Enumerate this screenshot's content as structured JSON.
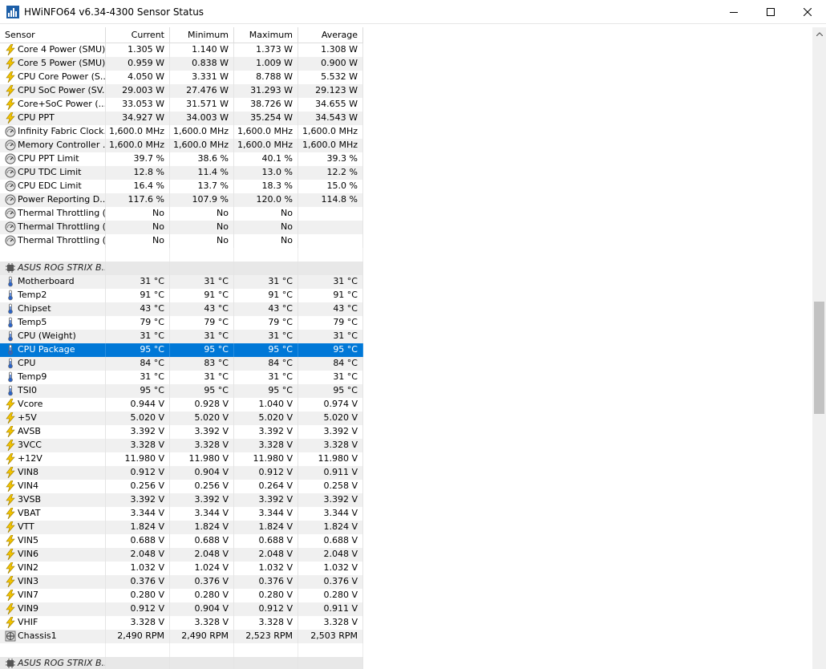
{
  "window": {
    "title": "HWiNFO64 v6.34-4300 Sensor Status"
  },
  "columns": {
    "sensor": "Sensor",
    "current": "Current",
    "minimum": "Minimum",
    "maximum": "Maximum",
    "average": "Average"
  },
  "rows": [
    {
      "type": "data",
      "icon": "bolt-icon",
      "name": "Core 4 Power (SMU)",
      "current": "1.305 W",
      "minimum": "1.140 W",
      "maximum": "1.373 W",
      "average": "1.308 W"
    },
    {
      "type": "data",
      "icon": "bolt-icon",
      "name": "Core 5 Power (SMU)",
      "current": "0.959 W",
      "minimum": "0.838 W",
      "maximum": "1.009 W",
      "average": "0.900 W"
    },
    {
      "type": "data",
      "icon": "bolt-icon",
      "name": "CPU Core Power (S...",
      "current": "4.050 W",
      "minimum": "3.331 W",
      "maximum": "8.788 W",
      "average": "5.532 W"
    },
    {
      "type": "data",
      "icon": "bolt-icon",
      "name": "CPU SoC Power (SV...",
      "current": "29.003 W",
      "minimum": "27.476 W",
      "maximum": "31.293 W",
      "average": "29.123 W"
    },
    {
      "type": "data",
      "icon": "bolt-icon",
      "name": "Core+SoC Power (...",
      "current": "33.053 W",
      "minimum": "31.571 W",
      "maximum": "38.726 W",
      "average": "34.655 W"
    },
    {
      "type": "data",
      "icon": "bolt-icon",
      "name": "CPU PPT",
      "current": "34.927 W",
      "minimum": "34.003 W",
      "maximum": "35.254 W",
      "average": "34.543 W"
    },
    {
      "type": "data",
      "icon": "gauge-icon",
      "name": "Infinity Fabric Clock...",
      "current": "1,600.0 MHz",
      "minimum": "1,600.0 MHz",
      "maximum": "1,600.0 MHz",
      "average": "1,600.0 MHz"
    },
    {
      "type": "data",
      "icon": "gauge-icon",
      "name": "Memory Controller ...",
      "current": "1,600.0 MHz",
      "minimum": "1,600.0 MHz",
      "maximum": "1,600.0 MHz",
      "average": "1,600.0 MHz"
    },
    {
      "type": "data",
      "icon": "gauge-icon",
      "name": "CPU PPT Limit",
      "current": "39.7 %",
      "minimum": "38.6 %",
      "maximum": "40.1 %",
      "average": "39.3 %"
    },
    {
      "type": "data",
      "icon": "gauge-icon",
      "name": "CPU TDC Limit",
      "current": "12.8 %",
      "minimum": "11.4 %",
      "maximum": "13.0 %",
      "average": "12.2 %"
    },
    {
      "type": "data",
      "icon": "gauge-icon",
      "name": "CPU EDC Limit",
      "current": "16.4 %",
      "minimum": "13.7 %",
      "maximum": "18.3 %",
      "average": "15.0 %"
    },
    {
      "type": "data",
      "icon": "gauge-icon",
      "name": "Power Reporting D...",
      "current": "117.6 %",
      "minimum": "107.9 %",
      "maximum": "120.0 %",
      "average": "114.8 %"
    },
    {
      "type": "data",
      "icon": "gauge-icon",
      "name": "Thermal Throttling (...",
      "current": "No",
      "minimum": "No",
      "maximum": "No",
      "average": ""
    },
    {
      "type": "data",
      "icon": "gauge-icon",
      "name": "Thermal Throttling (...",
      "current": "No",
      "minimum": "No",
      "maximum": "No",
      "average": ""
    },
    {
      "type": "data",
      "icon": "gauge-icon",
      "name": "Thermal Throttling (...",
      "current": "No",
      "minimum": "No",
      "maximum": "No",
      "average": ""
    },
    {
      "type": "blank"
    },
    {
      "type": "group",
      "icon": "chip-icon",
      "name": "ASUS ROG STRIX B..."
    },
    {
      "type": "data",
      "icon": "thermometer-icon",
      "name": "Motherboard",
      "current": "31 °C",
      "minimum": "31 °C",
      "maximum": "31 °C",
      "average": "31 °C"
    },
    {
      "type": "data",
      "icon": "thermometer-icon",
      "name": "Temp2",
      "current": "91 °C",
      "minimum": "91 °C",
      "maximum": "91 °C",
      "average": "91 °C"
    },
    {
      "type": "data",
      "icon": "thermometer-icon",
      "name": "Chipset",
      "current": "43 °C",
      "minimum": "43 °C",
      "maximum": "43 °C",
      "average": "43 °C"
    },
    {
      "type": "data",
      "icon": "thermometer-icon",
      "name": "Temp5",
      "current": "79 °C",
      "minimum": "79 °C",
      "maximum": "79 °C",
      "average": "79 °C"
    },
    {
      "type": "data",
      "icon": "thermometer-icon",
      "name": "CPU (Weight)",
      "current": "31 °C",
      "minimum": "31 °C",
      "maximum": "31 °C",
      "average": "31 °C"
    },
    {
      "type": "data",
      "icon": "thermometer-icon",
      "name": "CPU Package",
      "current": "95 °C",
      "minimum": "95 °C",
      "maximum": "95 °C",
      "average": "95 °C",
      "selected": true
    },
    {
      "type": "data",
      "icon": "thermometer-icon",
      "name": "CPU",
      "current": "84 °C",
      "minimum": "83 °C",
      "maximum": "84 °C",
      "average": "84 °C"
    },
    {
      "type": "data",
      "icon": "thermometer-icon",
      "name": "Temp9",
      "current": "31 °C",
      "minimum": "31 °C",
      "maximum": "31 °C",
      "average": "31 °C"
    },
    {
      "type": "data",
      "icon": "thermometer-icon",
      "name": "TSI0",
      "current": "95 °C",
      "minimum": "95 °C",
      "maximum": "95 °C",
      "average": "95 °C"
    },
    {
      "type": "data",
      "icon": "bolt-icon",
      "name": "Vcore",
      "current": "0.944 V",
      "minimum": "0.928 V",
      "maximum": "1.040 V",
      "average": "0.974 V"
    },
    {
      "type": "data",
      "icon": "bolt-icon",
      "name": "+5V",
      "current": "5.020 V",
      "minimum": "5.020 V",
      "maximum": "5.020 V",
      "average": "5.020 V"
    },
    {
      "type": "data",
      "icon": "bolt-icon",
      "name": "AVSB",
      "current": "3.392 V",
      "minimum": "3.392 V",
      "maximum": "3.392 V",
      "average": "3.392 V"
    },
    {
      "type": "data",
      "icon": "bolt-icon",
      "name": "3VCC",
      "current": "3.328 V",
      "minimum": "3.328 V",
      "maximum": "3.328 V",
      "average": "3.328 V"
    },
    {
      "type": "data",
      "icon": "bolt-icon",
      "name": "+12V",
      "current": "11.980 V",
      "minimum": "11.980 V",
      "maximum": "11.980 V",
      "average": "11.980 V"
    },
    {
      "type": "data",
      "icon": "bolt-icon",
      "name": "VIN8",
      "current": "0.912 V",
      "minimum": "0.904 V",
      "maximum": "0.912 V",
      "average": "0.911 V"
    },
    {
      "type": "data",
      "icon": "bolt-icon",
      "name": "VIN4",
      "current": "0.256 V",
      "minimum": "0.256 V",
      "maximum": "0.264 V",
      "average": "0.258 V"
    },
    {
      "type": "data",
      "icon": "bolt-icon",
      "name": "3VSB",
      "current": "3.392 V",
      "minimum": "3.392 V",
      "maximum": "3.392 V",
      "average": "3.392 V"
    },
    {
      "type": "data",
      "icon": "bolt-icon",
      "name": "VBAT",
      "current": "3.344 V",
      "minimum": "3.344 V",
      "maximum": "3.344 V",
      "average": "3.344 V"
    },
    {
      "type": "data",
      "icon": "bolt-icon",
      "name": "VTT",
      "current": "1.824 V",
      "minimum": "1.824 V",
      "maximum": "1.824 V",
      "average": "1.824 V"
    },
    {
      "type": "data",
      "icon": "bolt-icon",
      "name": "VIN5",
      "current": "0.688 V",
      "minimum": "0.688 V",
      "maximum": "0.688 V",
      "average": "0.688 V"
    },
    {
      "type": "data",
      "icon": "bolt-icon",
      "name": "VIN6",
      "current": "2.048 V",
      "minimum": "2.048 V",
      "maximum": "2.048 V",
      "average": "2.048 V"
    },
    {
      "type": "data",
      "icon": "bolt-icon",
      "name": "VIN2",
      "current": "1.032 V",
      "minimum": "1.024 V",
      "maximum": "1.032 V",
      "average": "1.032 V"
    },
    {
      "type": "data",
      "icon": "bolt-icon",
      "name": "VIN3",
      "current": "0.376 V",
      "minimum": "0.376 V",
      "maximum": "0.376 V",
      "average": "0.376 V"
    },
    {
      "type": "data",
      "icon": "bolt-icon",
      "name": "VIN7",
      "current": "0.280 V",
      "minimum": "0.280 V",
      "maximum": "0.280 V",
      "average": "0.280 V"
    },
    {
      "type": "data",
      "icon": "bolt-icon",
      "name": "VIN9",
      "current": "0.912 V",
      "minimum": "0.904 V",
      "maximum": "0.912 V",
      "average": "0.911 V"
    },
    {
      "type": "data",
      "icon": "bolt-icon",
      "name": "VHIF",
      "current": "3.328 V",
      "minimum": "3.328 V",
      "maximum": "3.328 V",
      "average": "3.328 V"
    },
    {
      "type": "data",
      "icon": "fan-icon",
      "name": "Chassis1",
      "current": "2,490 RPM",
      "minimum": "2,490 RPM",
      "maximum": "2,523 RPM",
      "average": "2,503 RPM"
    },
    {
      "type": "blank"
    },
    {
      "type": "group",
      "icon": "chip-icon",
      "name": "ASUS ROG STRIX B..."
    }
  ]
}
